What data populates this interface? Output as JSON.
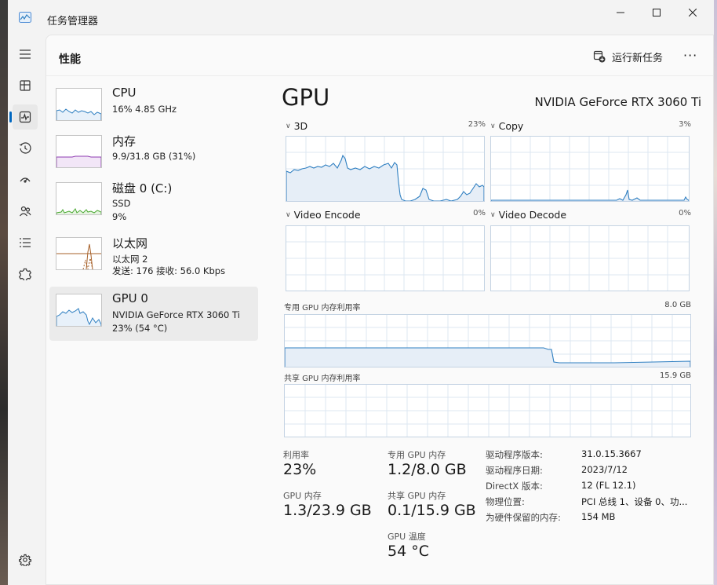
{
  "window": {
    "title": "任务管理器"
  },
  "header": {
    "page_title": "性能",
    "run_new_task": "运行新任务",
    "more": "···"
  },
  "nav": {
    "icons": [
      "hamburger-icon",
      "processes-icon",
      "performance-icon",
      "app-history-icon",
      "startup-apps-icon",
      "users-icon",
      "details-icon",
      "services-icon",
      "settings-icon"
    ]
  },
  "resources": [
    {
      "name": "CPU",
      "line1": "16% 4.85 GHz",
      "line2": ""
    },
    {
      "name": "内存",
      "line1": "9.9/31.8 GB (31%)",
      "line2": ""
    },
    {
      "name": "磁盘 0 (C:)",
      "line1": "SSD",
      "line2": "9%"
    },
    {
      "name": "以太网",
      "line1": "以太网 2",
      "line2": "发送: 176 接收: 56.0 Kbps"
    },
    {
      "name": "GPU 0",
      "line1": "NVIDIA GeForce RTX 3060 Ti",
      "line2": "23% (54 °C)"
    }
  ],
  "detail": {
    "title": "GPU",
    "model": "NVIDIA GeForce RTX 3060 Ti",
    "engines": [
      {
        "label": "3D",
        "percent": "23%"
      },
      {
        "label": "Copy",
        "percent": "3%"
      },
      {
        "label": "Video Encode",
        "percent": "0%"
      },
      {
        "label": "Video Decode",
        "percent": "0%"
      }
    ],
    "dedicated_label": "专用 GPU 内存利用率",
    "dedicated_max": "8.0 GB",
    "shared_label": "共享 GPU 内存利用率",
    "shared_max": "15.9 GB",
    "stats": {
      "utilization_label": "利用率",
      "utilization_value": "23%",
      "dedicated_mem_label": "专用 GPU 内存",
      "dedicated_mem_value": "1.2/8.0 GB",
      "gpu_mem_label": "GPU 内存",
      "gpu_mem_value": "1.3/23.9 GB",
      "shared_mem_label": "共享 GPU 内存",
      "shared_mem_value": "0.1/15.9 GB",
      "temp_label": "GPU 温度",
      "temp_value": "54 °C"
    },
    "info": [
      {
        "key": "驱动程序版本:",
        "value": "31.0.15.3667"
      },
      {
        "key": "驱动程序日期:",
        "value": "2023/7/12"
      },
      {
        "key": "DirectX 版本:",
        "value": "12 (FL 12.1)"
      },
      {
        "key": "物理位置:",
        "value": "PCI 总线 1、设备 0、功..."
      },
      {
        "key": "为硬件保留的内存:",
        "value": "154 MB"
      }
    ]
  },
  "colors": {
    "cpu": "#2f7fc1",
    "memory": "#8e3bb0",
    "disk": "#4aa832",
    "ethernet": "#a7612a",
    "gpu": "#2f7fc1"
  }
}
